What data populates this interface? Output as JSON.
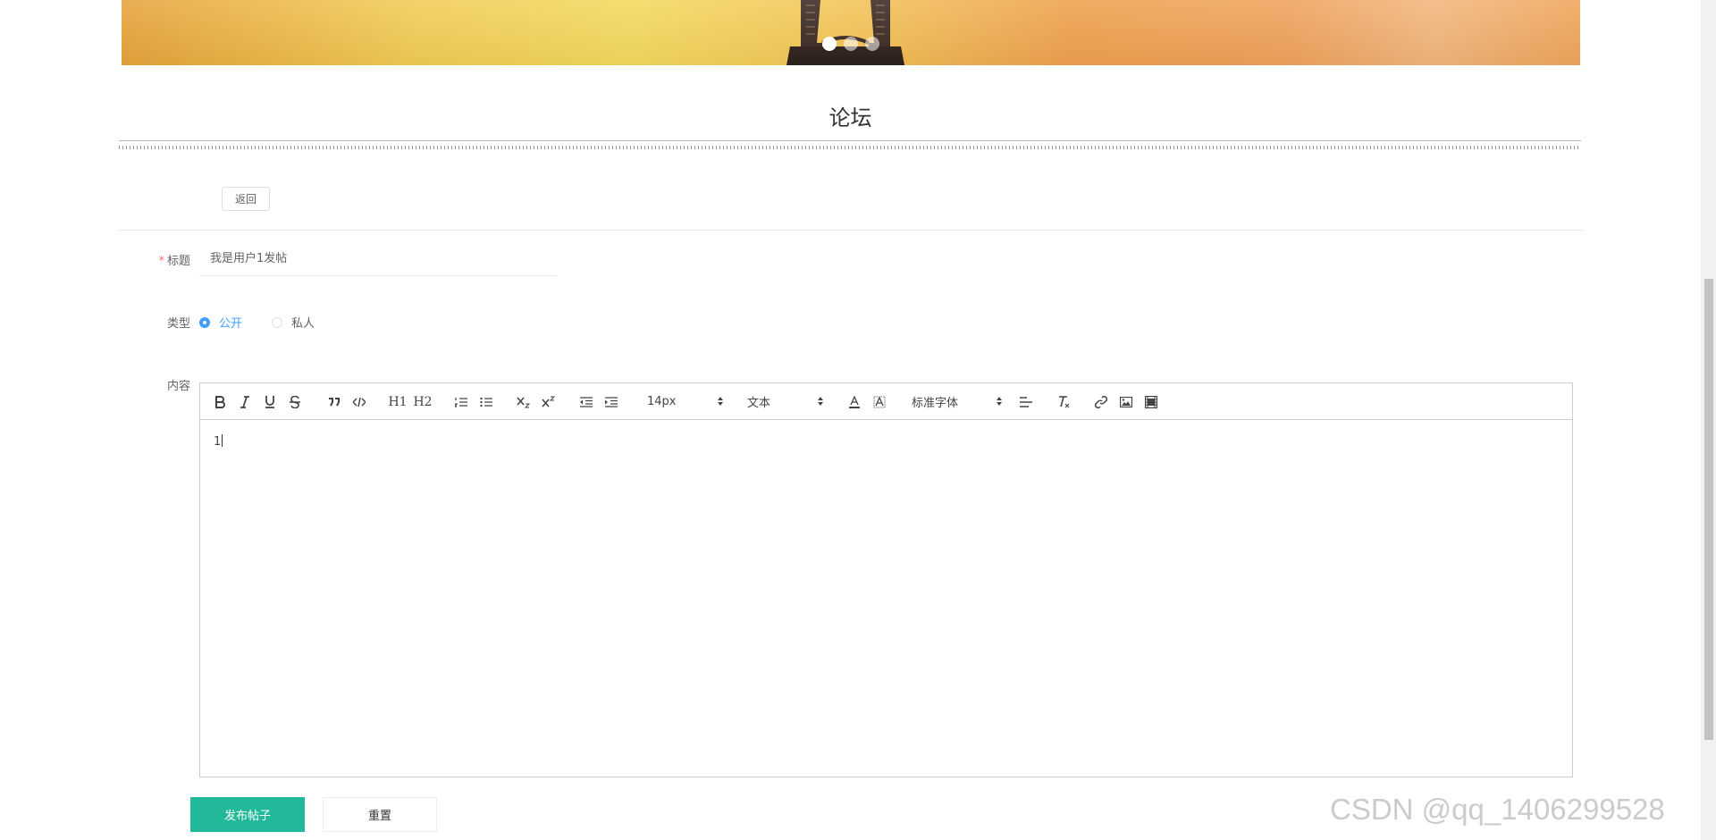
{
  "banner": {
    "carousel_dots": 3,
    "active_dot": 1
  },
  "page": {
    "title": "论坛"
  },
  "actions": {
    "back_label": "返回"
  },
  "form": {
    "title": {
      "label": "标题",
      "required_mark": "*",
      "value": "我是用户1发帖"
    },
    "type": {
      "label": "类型",
      "options": [
        "公开",
        "私人"
      ],
      "selected": "公开"
    },
    "content": {
      "label": "内容",
      "body": "1"
    }
  },
  "editor_toolbar": {
    "heading1": "H1",
    "heading2": "H2",
    "size_picker": "14px",
    "header_picker": "文本",
    "font_picker": "标准字体",
    "icons": [
      "bold-icon",
      "italic-icon",
      "underline-icon",
      "strike-icon",
      "blockquote-icon",
      "code-block-icon",
      "ordered-list-icon",
      "bullet-list-icon",
      "subscript-icon",
      "superscript-icon",
      "outdent-icon",
      "indent-icon",
      "font-color-icon",
      "background-color-icon",
      "align-icon",
      "clear-format-icon",
      "link-icon",
      "image-icon",
      "video-icon"
    ]
  },
  "buttons": {
    "submit": "发布帖子",
    "reset": "重置"
  },
  "watermark": "CSDN @qq_1406299528",
  "colors": {
    "primary": "#22b99a",
    "radio_active": "#409eff",
    "required": "#f56c6c"
  }
}
